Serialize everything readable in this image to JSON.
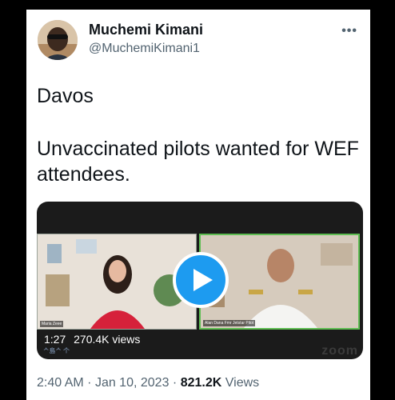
{
  "tweet": {
    "author_name": "Muchemi Kimani",
    "author_handle": "@MuchemiKimani1",
    "more_icon": "more-horizontal-icon",
    "text_line1": "Davos",
    "text_line2": "Unvaccinated pilots wanted for WEF attendees.",
    "time": "2:40 AM",
    "sep1": "·",
    "date": "Jan 10, 2023",
    "sep2": "·",
    "views_count": "821.2K",
    "views_label": "Views"
  },
  "video": {
    "duration": "1:27",
    "views": "270.4K views",
    "left_caption": "Maria Zeee",
    "right_caption": "Alan Dana Fmr Jetstar Pilot",
    "watermark": "ᄉ島ᄉ 个",
    "zoom_mark": "zoom",
    "play_icon": "play-icon",
    "accent": "#1d9bf0"
  }
}
